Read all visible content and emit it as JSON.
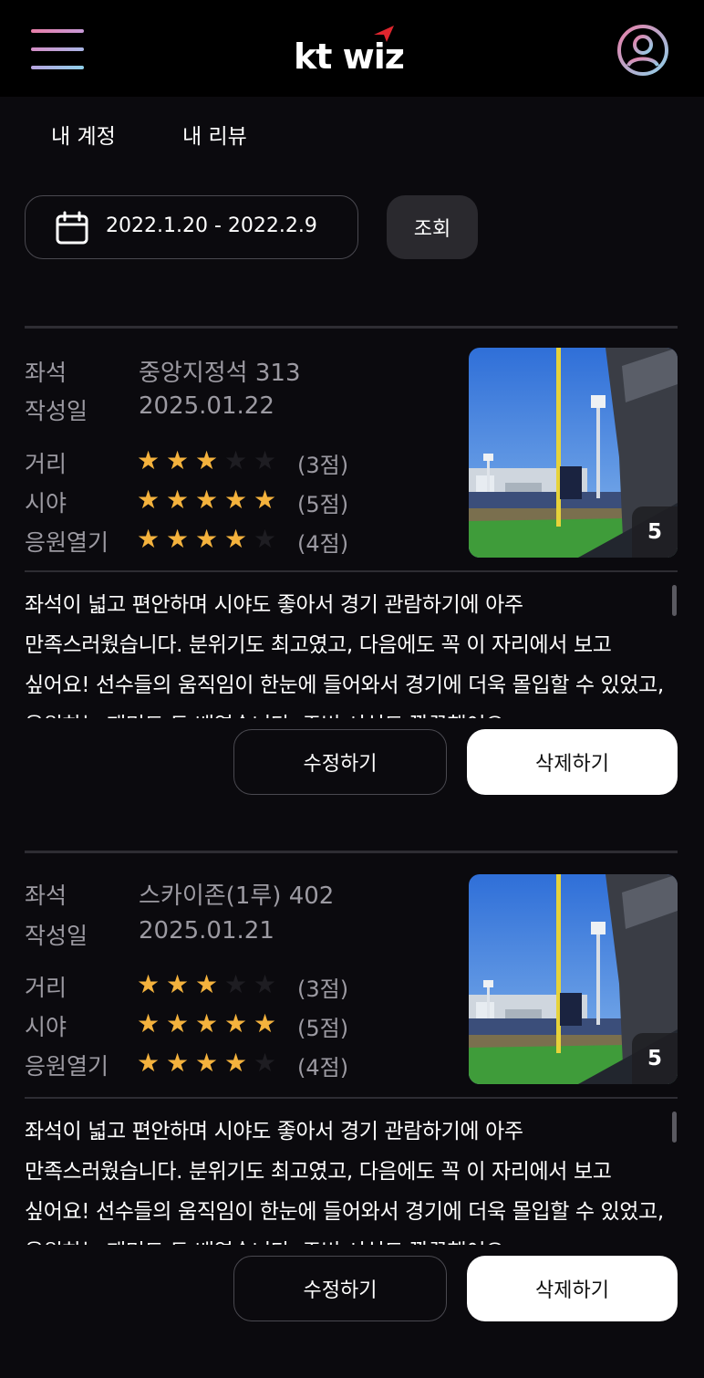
{
  "header": {
    "brand": "kt wiz",
    "menu_icon": "hamburger-menu-icon",
    "profile_icon": "user-profile-icon",
    "colors": {
      "logo_mark": "#e0262e",
      "menu_gradient_start": "#e87ea8",
      "menu_gradient_end": "#8fd0ea"
    }
  },
  "tabs": [
    {
      "label": "내 계정"
    },
    {
      "label": "내 리뷰"
    }
  ],
  "filter": {
    "icon": "calendar-icon",
    "date_range": "2022.1.20 - 2022.2.9",
    "search_label": "조회"
  },
  "labels": {
    "seat": "좌석",
    "created": "작성일",
    "distance": "거리",
    "view": "시야",
    "cheering": "응원열기"
  },
  "colors": {
    "star_on": "#f4b23d",
    "star_off": "#1e1d22",
    "background": "#0b0a0e"
  },
  "reviews": [
    {
      "seat": "중앙지정석 313",
      "date": "2025.01.22",
      "ratings": {
        "distance": 3,
        "view": 5,
        "cheering": 4
      },
      "scores": {
        "distance": "(3점)",
        "view": "(5점)",
        "cheering": "(4점)"
      },
      "photo_count": "5",
      "text": "좌석이 넓고 편안하며 시야도 좋아서 경기 관람하기에 아주 만족스러웠습니다. 분위기도 최고였고, 다음에도 꼭 이 자리에서 보고 싶어요! 선수들의 움직임이 한눈에 들어와서 경기에 더욱 몰입할 수 있었고, 응원하는 재미도 두 배였습니다. 주변 시설도 깔끔했어요.",
      "edit_label": "수정하기",
      "delete_label": "삭제하기"
    },
    {
      "seat": "스카이존(1루) 402",
      "date": "2025.01.21",
      "ratings": {
        "distance": 3,
        "view": 5,
        "cheering": 4
      },
      "scores": {
        "distance": "(3점)",
        "view": "(5점)",
        "cheering": "(4점)"
      },
      "photo_count": "5",
      "text": "좌석이 넓고 편안하며 시야도 좋아서 경기 관람하기에 아주 만족스러웠습니다. 분위기도 최고였고, 다음에도 꼭 이 자리에서 보고 싶어요! 선수들의 움직임이 한눈에 들어와서 경기에 더욱 몰입할 수 있었고, 응원하는 재미도 두 배였습니다. 주변 시설도 깔끔했어요.",
      "edit_label": "수정하기",
      "delete_label": "삭제하기"
    }
  ]
}
